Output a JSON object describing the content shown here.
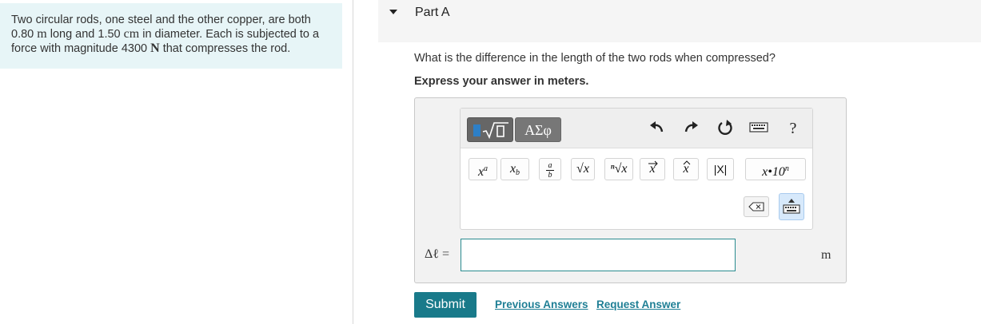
{
  "problem": {
    "line1": "Two circular rods, one steel and the other copper, are both",
    "line2_a": "0.80 ",
    "line2_m": "m",
    "line2_b": " long and 1.50 ",
    "line2_cm": "cm",
    "line2_c": " in diameter. Each is subjected to a",
    "line3_a": "force with magnitude 4300 ",
    "line3_N": "N",
    "line3_b": " that compresses the rod."
  },
  "part": {
    "title": "Part A"
  },
  "question": "What is the difference in the length of the two rods when compressed?",
  "instruction": "Express your answer in meters.",
  "toolbar": {
    "greek_label": "ΑΣφ",
    "help_label": "?",
    "buttons": {
      "superscript": {
        "base": "x",
        "sup": "a"
      },
      "subscript": {
        "base": "x",
        "sub": "b"
      },
      "fraction": {
        "num": "a",
        "den": "b"
      },
      "sqrt": "√x",
      "nth_root": "ⁿ√x",
      "vector": "x",
      "unit_vector": "x",
      "abs": "|X|",
      "sci": {
        "base": "x•10",
        "sup": "n"
      }
    }
  },
  "answer": {
    "label": "Δℓ =",
    "value": "",
    "unit": "m"
  },
  "actions": {
    "submit": "Submit",
    "previous_answers": "Previous Answers",
    "request_answer": "Request Answer"
  },
  "colors": {
    "accent": "#197a8a",
    "link": "#1f7f95",
    "panel_bg": "#e7f5f7",
    "template_blue": "#2d7fc6"
  }
}
